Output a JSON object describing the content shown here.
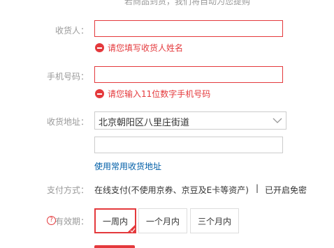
{
  "header": {
    "note": "若商品到货，我们将自动为您提购"
  },
  "form": {
    "receiver": {
      "label": "收货人：",
      "value": "",
      "error": "请您填写收货人姓名"
    },
    "phone": {
      "label": "手机号码：",
      "value": "",
      "error": "请您输入11位数字手机号码"
    },
    "address": {
      "label": "收货地址：",
      "region": "北京朝阳区八里庄街道",
      "detail": "",
      "common_link": "使用常用收货地址"
    },
    "payment": {
      "label": "支付方式：",
      "method": "在线支付(不使用京券、京豆及E卡等资产)",
      "separator": "|",
      "status": "已开启免密"
    },
    "validity": {
      "help_glyph": "?",
      "label": "有效期：",
      "options": [
        {
          "label": "一周内",
          "selected": true
        },
        {
          "label": "一个月内",
          "selected": false
        },
        {
          "label": "三个月内",
          "selected": false
        }
      ]
    }
  },
  "colors": {
    "accent": "#e4393c",
    "link": "#005ea7",
    "label": "#999999",
    "text": "#333333"
  },
  "icons": {
    "error": "minus-circle-icon",
    "help": "question-circle-icon",
    "dropdown": "chevron-down-icon",
    "selected": "check-corner-icon"
  }
}
